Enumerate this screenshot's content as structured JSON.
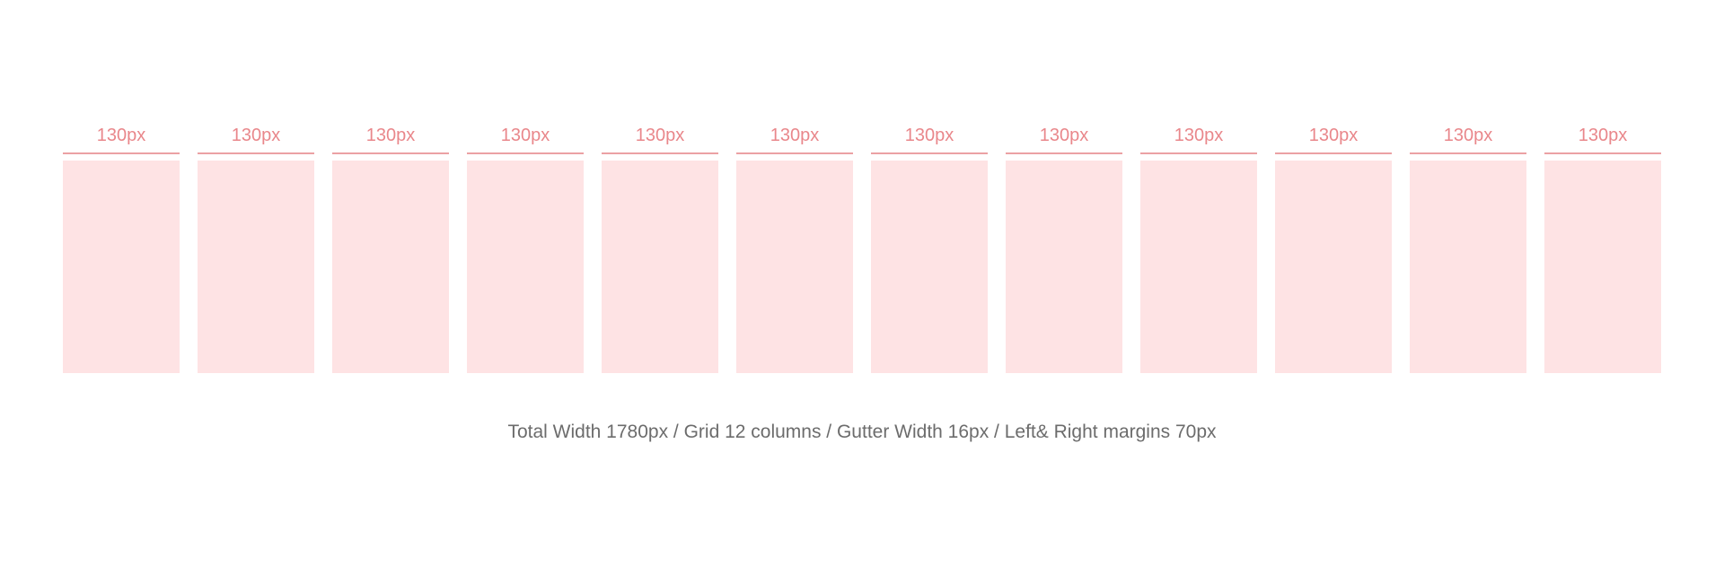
{
  "colors": {
    "accent": "#e9878b",
    "rule": "#eba1a4",
    "column_fill": "#fee3e4",
    "caption": "#6c6c6c",
    "background": "#ffffff"
  },
  "columns": [
    {
      "label": "130px"
    },
    {
      "label": "130px"
    },
    {
      "label": "130px"
    },
    {
      "label": "130px"
    },
    {
      "label": "130px"
    },
    {
      "label": "130px"
    },
    {
      "label": "130px"
    },
    {
      "label": "130px"
    },
    {
      "label": "130px"
    },
    {
      "label": "130px"
    },
    {
      "label": "130px"
    },
    {
      "label": "130px"
    }
  ],
  "caption": "Total Width 1780px / Grid 12 columns / Gutter Width 16px / Left& Right margins 70px"
}
